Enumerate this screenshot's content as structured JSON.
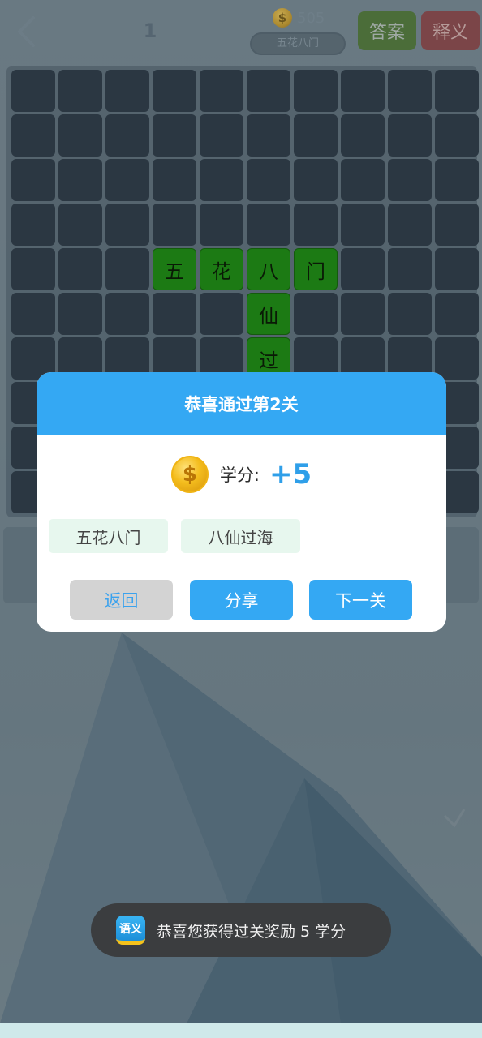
{
  "header": {
    "level": "1",
    "coins": "505",
    "coin_icon": "coin-icon",
    "current_idiom": "五花八门",
    "answer_label": "答案",
    "explain_label": "释义",
    "back_icon": "chevron-left-icon",
    "answer_color": "#4b6d39",
    "explain_color": "#7b4548"
  },
  "grid": {
    "rows": 10,
    "cols": 10,
    "filled": [
      {
        "row": 4,
        "col": 3,
        "char": "五"
      },
      {
        "row": 4,
        "col": 4,
        "char": "花"
      },
      {
        "row": 4,
        "col": 5,
        "char": "八"
      },
      {
        "row": 4,
        "col": 6,
        "char": "门"
      },
      {
        "row": 5,
        "col": 5,
        "char": "仙"
      },
      {
        "row": 6,
        "col": 5,
        "char": "过"
      }
    ],
    "filled_color": "#1c7a14",
    "empty_color": "#2b3742"
  },
  "modal": {
    "title": "恭喜通过第2关",
    "reward_icon": "coin-icon",
    "reward_label": "学分:",
    "reward_value": "+5",
    "idioms": [
      "五花八门",
      "八仙过海"
    ],
    "back_label": "返回",
    "share_label": "分享",
    "next_label": "下一关",
    "accent_color": "#34a8f3"
  },
  "toast": {
    "icon_label": "语义",
    "message": "恭喜您获得过关奖励 5 学分"
  }
}
